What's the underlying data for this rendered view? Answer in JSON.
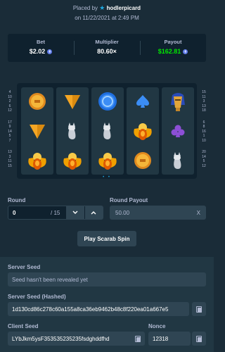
{
  "header": {
    "placed_by_label": "Placed by",
    "username": "hodlerpicard",
    "date_line": "on 11/22/2021 at 2:49 PM"
  },
  "stats": {
    "bet_label": "Bet",
    "bet_value": "$2.02",
    "multiplier_label": "Multiplier",
    "multiplier_value": "80.60×",
    "payout_label": "Payout",
    "payout_value": "$162.81",
    "currency_icon": "eth-coin-icon",
    "payout_color": "#00e701"
  },
  "board": {
    "columns": [
      [
        "coin",
        "pyramid",
        "scarab"
      ],
      [
        "pyramid",
        "cat",
        "scarab"
      ],
      [
        "ring",
        "cat",
        "scarab"
      ],
      [
        "spade",
        "scarab",
        "coin"
      ],
      [
        "pharaoh",
        "club",
        "cat"
      ]
    ],
    "left_numbers": [
      "4",
      "10",
      "2",
      "6",
      "12",
      "17",
      "9",
      "14",
      "5",
      "7",
      "13",
      "3",
      "11",
      "15"
    ],
    "right_numbers": [
      "15",
      "11",
      "3",
      "13",
      "18",
      "6",
      "8",
      "16",
      "1",
      "10",
      "20",
      "14",
      "5",
      "12"
    ],
    "indicator": "• •"
  },
  "round": {
    "label": "Round",
    "value": "0",
    "total": "/ 15"
  },
  "round_payout": {
    "label": "Round Payout",
    "value": "50.00",
    "clear": "X"
  },
  "play_button": "Play Scarab Spin",
  "seeds": {
    "server_seed_label": "Server Seed",
    "server_seed_value": "Seed hasn't been revealed yet",
    "server_hashed_label": "Server Seed (Hashed)",
    "server_hashed_value": "1d130cd86c278c60a155a8ca36eb9462b48c8f220ea01a667e5",
    "client_seed_label": "Client Seed",
    "client_seed_value": "LYbJkm5ysF353535235235fsdghddfhd",
    "nonce_label": "Nonce",
    "nonce_value": "12318"
  }
}
